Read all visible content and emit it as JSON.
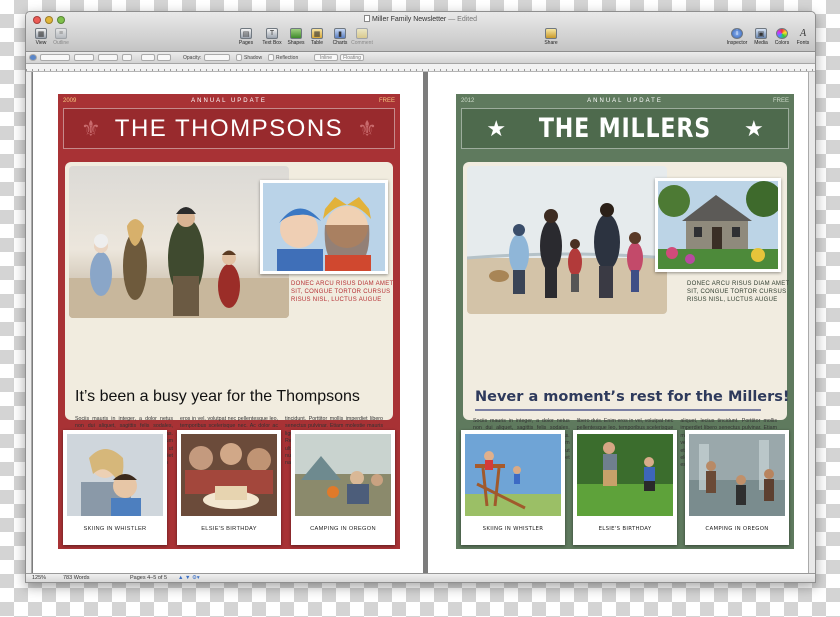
{
  "window": {
    "title": "Miller Family Newsletter",
    "title_suffix": "— Edited"
  },
  "toolbar": {
    "left": [
      {
        "label": "View",
        "icon": "view-icon"
      },
      {
        "label": "Outline",
        "icon": "outline-icon"
      }
    ],
    "center": [
      {
        "label": "Pages",
        "icon": "pages-icon"
      },
      {
        "label": "Text Box",
        "icon": "text-box-icon"
      },
      {
        "label": "Shapes",
        "icon": "shapes-icon"
      },
      {
        "label": "Table",
        "icon": "table-icon"
      },
      {
        "label": "Charts",
        "icon": "charts-icon"
      },
      {
        "label": "Comment",
        "icon": "comment-icon"
      }
    ],
    "share": {
      "label": "Share",
      "icon": "share-icon"
    },
    "right": [
      {
        "label": "Inspector",
        "icon": "inspector-icon"
      },
      {
        "label": "Media",
        "icon": "media-icon"
      },
      {
        "label": "Colors",
        "icon": "colors-icon"
      },
      {
        "label": "Fonts",
        "icon": "fonts-icon"
      }
    ]
  },
  "format_bar": {
    "opacity_label": "Opacity:",
    "shadow_label": "Shadow",
    "reflection_label": "Reflection",
    "inline_label": "Inline",
    "floating_label": "Floating"
  },
  "status_bar": {
    "zoom": "125%",
    "words": "783 Words",
    "pages": "Pages 4–5 of 5"
  },
  "thompsons": {
    "year": "2009",
    "annual": "ANNUAL UPDATE",
    "free": "FREE",
    "title": "THE THOMPSONS",
    "photo_caption": "DONEC ARCU RISUS DIAM AMET SIT, CONGUE TORTOR CURSUS RISUS NISL, LUCTUS AUGUE",
    "headline": "It’s been a busy year for the Thompsons",
    "columns": [
      "Sociis mauris in integer, a dolor netus non dui aliquet, sagittis felis sodales, dolor sociis mauris, vel eu libero cras. Interdum at. Eget habitasse elementum est, ipsum purus pede porttitor class, ut adipiscing, aliquet sed auctor, imperdiet arcu per diam dapibus libero duis. Enim",
      "eros in vel, volutpat nec pellentesque leo, temporibus scelerisque nec. Ac dolor ac adipiscing amet bibendum nullam, massa lacus molestie ut libero nec, diam et, pharetra sodales eget, feugiat ullamcorper id tempor eget id vitae. Mauris pretium eget aliquet, lectus",
      "tincidunt. Porttitor mollis imperdiet libero senectus pulvinar. Etiam molestie mauris ligula eget laoreet, vehicula eleifend. Repellat orci eget erat et, sem cum, ultricies sollicitudin amet eleifend dolor nullam erat, malesuada est leo ac. Varius natoque turpis elementum est."
    ],
    "photos": [
      "SKIING IN WHISTLER",
      "ELSIE'S BIRTHDAY",
      "CAMPING IN OREGON"
    ],
    "colors": {
      "panel": "#a83235",
      "caption": "#b52f33"
    }
  },
  "millers": {
    "year": "2012",
    "annual": "ANNUAL UPDATE",
    "free": "FREE",
    "title": "THE MILLERS",
    "photo_caption": "DONEC ARCU RISUS DIAM AMET SIT, CONGUE TORTOR CURSUS RISUS NISL, LUCTUS AUGUE",
    "headline": "Never a moment’s rest for the Millers!",
    "columns": [
      "Sociis mauris in integer, a dolor netus non dui aliquet, sagittis felis sodales, dolor sociis mauris, vel eu libero cras. Interdum at. Eget habitasse elementum est, ipsum purus pede porttitor class, ut adipiscing, aliquet sed auctor, imperdiet arcu per diam dapibus",
      "libero duis. Enim eros in vel, volutpat nec pellentesque leo, temporibus scelerisque nec. Ac dolor ac adipiscing amet bibendum nullam, massa lacus molestie ut libero nec, diam et, pharetra sodales eget, feugiat ullamcorper id tempor eget id vitae. Mauris pretium eget",
      "aliquet, lectus tincidunt. Porttitor mollis imperdiet libero senectus pulvinar. Etiam molestie mauris ligula eget laoreet, vehicula eleifend. Repellat orci eget erat et, sem cum, ultricies sollicitudin amet eleifend dolor nullam erat, malesuada est leo ac."
    ],
    "photos": [
      "SKIING IN WHISTLER",
      "ELSIE'S BIRTHDAY",
      "CAMPING IN OREGON"
    ],
    "colors": {
      "panel": "#5f7a5e",
      "caption": "#2f3d2f"
    }
  }
}
